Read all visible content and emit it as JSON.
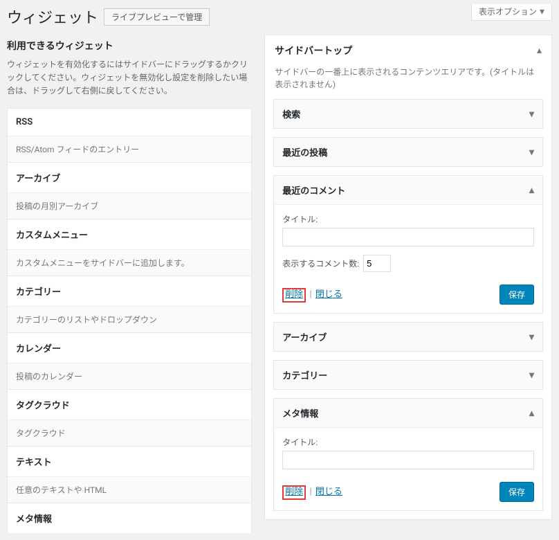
{
  "header": {
    "page_title": "ウィジェット",
    "live_preview_btn": "ライブプレビューで管理",
    "screen_options": "表示オプション"
  },
  "available": {
    "heading": "利用できるウィジェット",
    "help": "ウィジェットを有効化するにはサイドバーにドラッグするかクリックしてください。ウィジェットを無効化し設定を削除したい場合は、ドラッグして右側に戻してください。",
    "widgets": [
      {
        "title": "RSS",
        "desc": "RSS/Atom フィードのエントリー"
      },
      {
        "title": "アーカイブ",
        "desc": "投稿の月別アーカイブ"
      },
      {
        "title": "カスタムメニュー",
        "desc": "カスタムメニューをサイドバーに追加します。"
      },
      {
        "title": "カテゴリー",
        "desc": "カテゴリーのリストやドロップダウン"
      },
      {
        "title": "カレンダー",
        "desc": "投稿のカレンダー"
      },
      {
        "title": "タグクラウド",
        "desc": "タグクラウド"
      },
      {
        "title": "テキスト",
        "desc": "任意のテキストや HTML"
      },
      {
        "title": "メタ情報",
        "desc": ""
      }
    ]
  },
  "sidebar": {
    "title": "サイドバートップ",
    "desc": "サイドバーの一番上に表示されるコンテンツエリアです。(タイトルは表示されません)",
    "widgets": [
      {
        "title": "検索",
        "open": false
      },
      {
        "title": "最近の投稿",
        "open": false
      },
      {
        "title": "最近のコメント",
        "open": true,
        "form": {
          "title_label": "タイトル:",
          "title_value": "",
          "count_label": "表示するコメント数:",
          "count_value": "5"
        }
      },
      {
        "title": "アーカイブ",
        "open": false
      },
      {
        "title": "カテゴリー",
        "open": false
      },
      {
        "title": "メタ情報",
        "open": true,
        "form": {
          "title_label": "タイトル:",
          "title_value": ""
        }
      }
    ]
  },
  "actions": {
    "delete": "削除",
    "close": "閉じる",
    "save": "保存"
  }
}
